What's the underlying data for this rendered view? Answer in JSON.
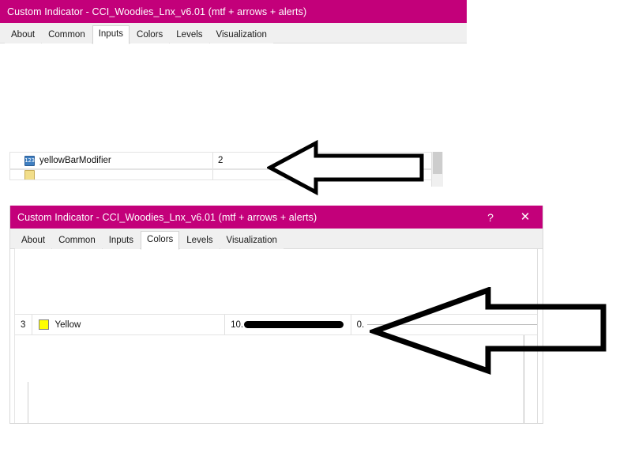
{
  "windows": [
    {
      "id": "window-inputs",
      "title": "Custom Indicator - CCI_Woodies_Lnx_v6.01 (mtf + arrows + alerts)",
      "titlebar_color": "#c3007a",
      "buttons": [],
      "tabs": [
        {
          "label": "About",
          "active": false
        },
        {
          "label": "Common",
          "active": false
        },
        {
          "label": "Inputs",
          "active": true
        },
        {
          "label": "Colors",
          "active": false
        },
        {
          "label": "Levels",
          "active": false
        },
        {
          "label": "Visualization",
          "active": false
        }
      ],
      "rows": [
        {
          "icon": "number-123-icon",
          "name": "yellowBarModifier",
          "value": "2"
        },
        {
          "icon": "folder-icon",
          "name": "",
          "value": ""
        }
      ]
    },
    {
      "id": "window-colors",
      "title": "Custom Indicator - CCI_Woodies_Lnx_v6.01 (mtf + arrows + alerts)",
      "titlebar_color": "#c3007a",
      "buttons": [
        {
          "name": "help-button",
          "glyph": "?"
        },
        {
          "name": "close-button",
          "glyph": "✕"
        }
      ],
      "tabs": [
        {
          "label": "About",
          "active": false
        },
        {
          "label": "Common",
          "active": false
        },
        {
          "label": "Inputs",
          "active": false
        },
        {
          "label": "Colors",
          "active": true
        },
        {
          "label": "Levels",
          "active": false
        },
        {
          "label": "Visualization",
          "active": false
        }
      ],
      "color_row": {
        "index": "3",
        "swatch_color": "#ffff00",
        "color_name": "Yellow",
        "width_value": "10.",
        "style_value": "0."
      }
    }
  ],
  "annotations": [
    {
      "name": "annotation-arrow-inputs",
      "direction": "left",
      "style": "outline-filled"
    },
    {
      "name": "annotation-arrow-colors",
      "direction": "left",
      "style": "outline-transparent"
    }
  ]
}
